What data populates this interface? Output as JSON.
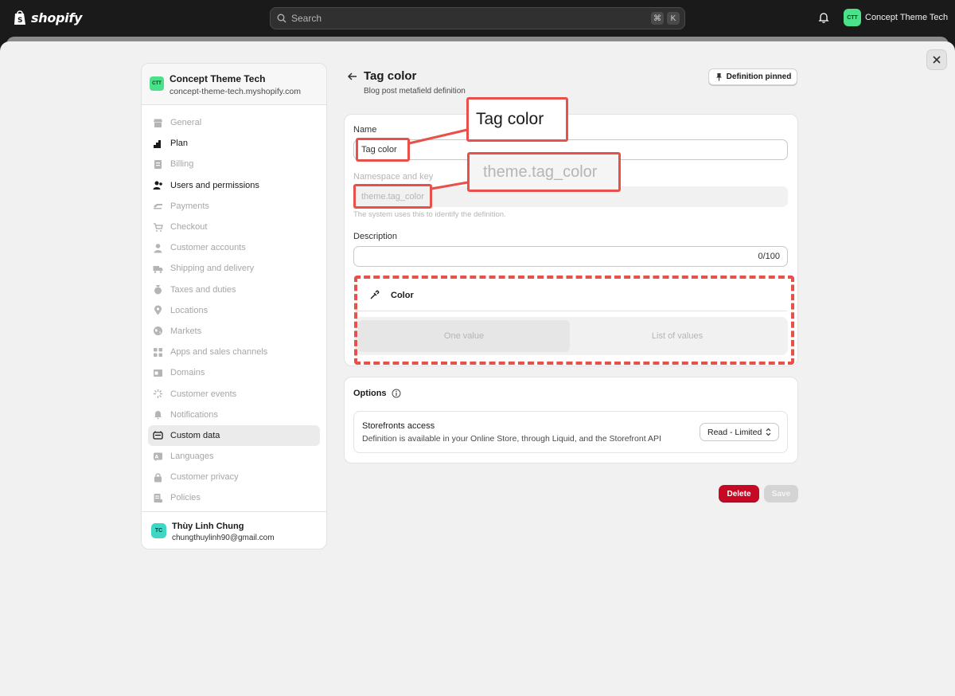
{
  "topbar": {
    "brand": "shopify",
    "search_placeholder": "Search",
    "kbd1": "⌘",
    "kbd2": "K",
    "store_initials": "CTT",
    "store_name": "Concept Theme Tech"
  },
  "sidebar": {
    "store_initials": "CTT",
    "store_name": "Concept Theme Tech",
    "store_url": "concept-theme-tech.myshopify.com",
    "items": [
      {
        "label": "General",
        "icon": "store-icon"
      },
      {
        "label": "Plan",
        "icon": "plan-icon"
      },
      {
        "label": "Billing",
        "icon": "billing-icon"
      },
      {
        "label": "Users and permissions",
        "icon": "users-icon"
      },
      {
        "label": "Payments",
        "icon": "payments-icon"
      },
      {
        "label": "Checkout",
        "icon": "cart-icon"
      },
      {
        "label": "Customer accounts",
        "icon": "person-icon"
      },
      {
        "label": "Shipping and delivery",
        "icon": "truck-icon"
      },
      {
        "label": "Taxes and duties",
        "icon": "tax-icon"
      },
      {
        "label": "Locations",
        "icon": "location-pin-icon"
      },
      {
        "label": "Markets",
        "icon": "globe-icon"
      },
      {
        "label": "Apps and sales channels",
        "icon": "apps-icon"
      },
      {
        "label": "Domains",
        "icon": "domain-icon"
      },
      {
        "label": "Customer events",
        "icon": "events-icon"
      },
      {
        "label": "Notifications",
        "icon": "bell-icon"
      },
      {
        "label": "Custom data",
        "icon": "custom-data-icon"
      },
      {
        "label": "Languages",
        "icon": "language-icon"
      },
      {
        "label": "Customer privacy",
        "icon": "lock-icon"
      },
      {
        "label": "Policies",
        "icon": "policy-icon"
      }
    ],
    "user_initials": "TC",
    "user_name": "Thùy Linh Chung",
    "user_email": "chungthuylinh90@gmail.com"
  },
  "page": {
    "title": "Tag color",
    "subtitle": "Blog post metafield definition",
    "pin_label": "Definition pinned"
  },
  "form": {
    "name_label": "Name",
    "name_value": "Tag color",
    "ns_label": "Namespace and key",
    "ns_value": "theme.tag_color",
    "ns_help": "The system uses this to identify the definition.",
    "desc_label": "Description",
    "desc_counter": "0/100",
    "type_label": "Color",
    "seg_one": "One value",
    "seg_list": "List of values"
  },
  "options": {
    "title": "Options",
    "access_title": "Storefronts access",
    "access_desc": "Definition is available in your Online Store, through Liquid, and the Storefront API",
    "access_value": "Read - Limited"
  },
  "actions": {
    "delete": "Delete",
    "save": "Save"
  },
  "annotations": {
    "callout_name": "Tag color",
    "callout_ns": "theme.tag_color",
    "color": "#e8514a"
  }
}
